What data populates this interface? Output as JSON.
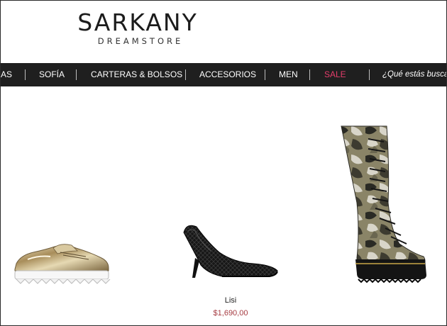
{
  "brand": {
    "name": "SARKANY",
    "tagline": "DREAMSTORE"
  },
  "nav": {
    "items": [
      {
        "label": "AS"
      },
      {
        "label": "SOFÍA"
      },
      {
        "label": "CARTERAS & BOLSOS"
      },
      {
        "label": "ACCESORIOS"
      },
      {
        "label": "MEN"
      },
      {
        "label": "SALE"
      }
    ],
    "search_placeholder": "¿Qué estás buscando?"
  },
  "products": [
    {
      "image": "gold-platform-oxford-shoe"
    },
    {
      "image": "black-snakeskin-pump",
      "name": "Lisi",
      "price": "$1,690,00"
    },
    {
      "image": "camouflage-lace-up-boot"
    }
  ],
  "colors": {
    "nav_bg": "#1f1f1f",
    "sale": "#e43d6b",
    "price": "#a53a40"
  }
}
